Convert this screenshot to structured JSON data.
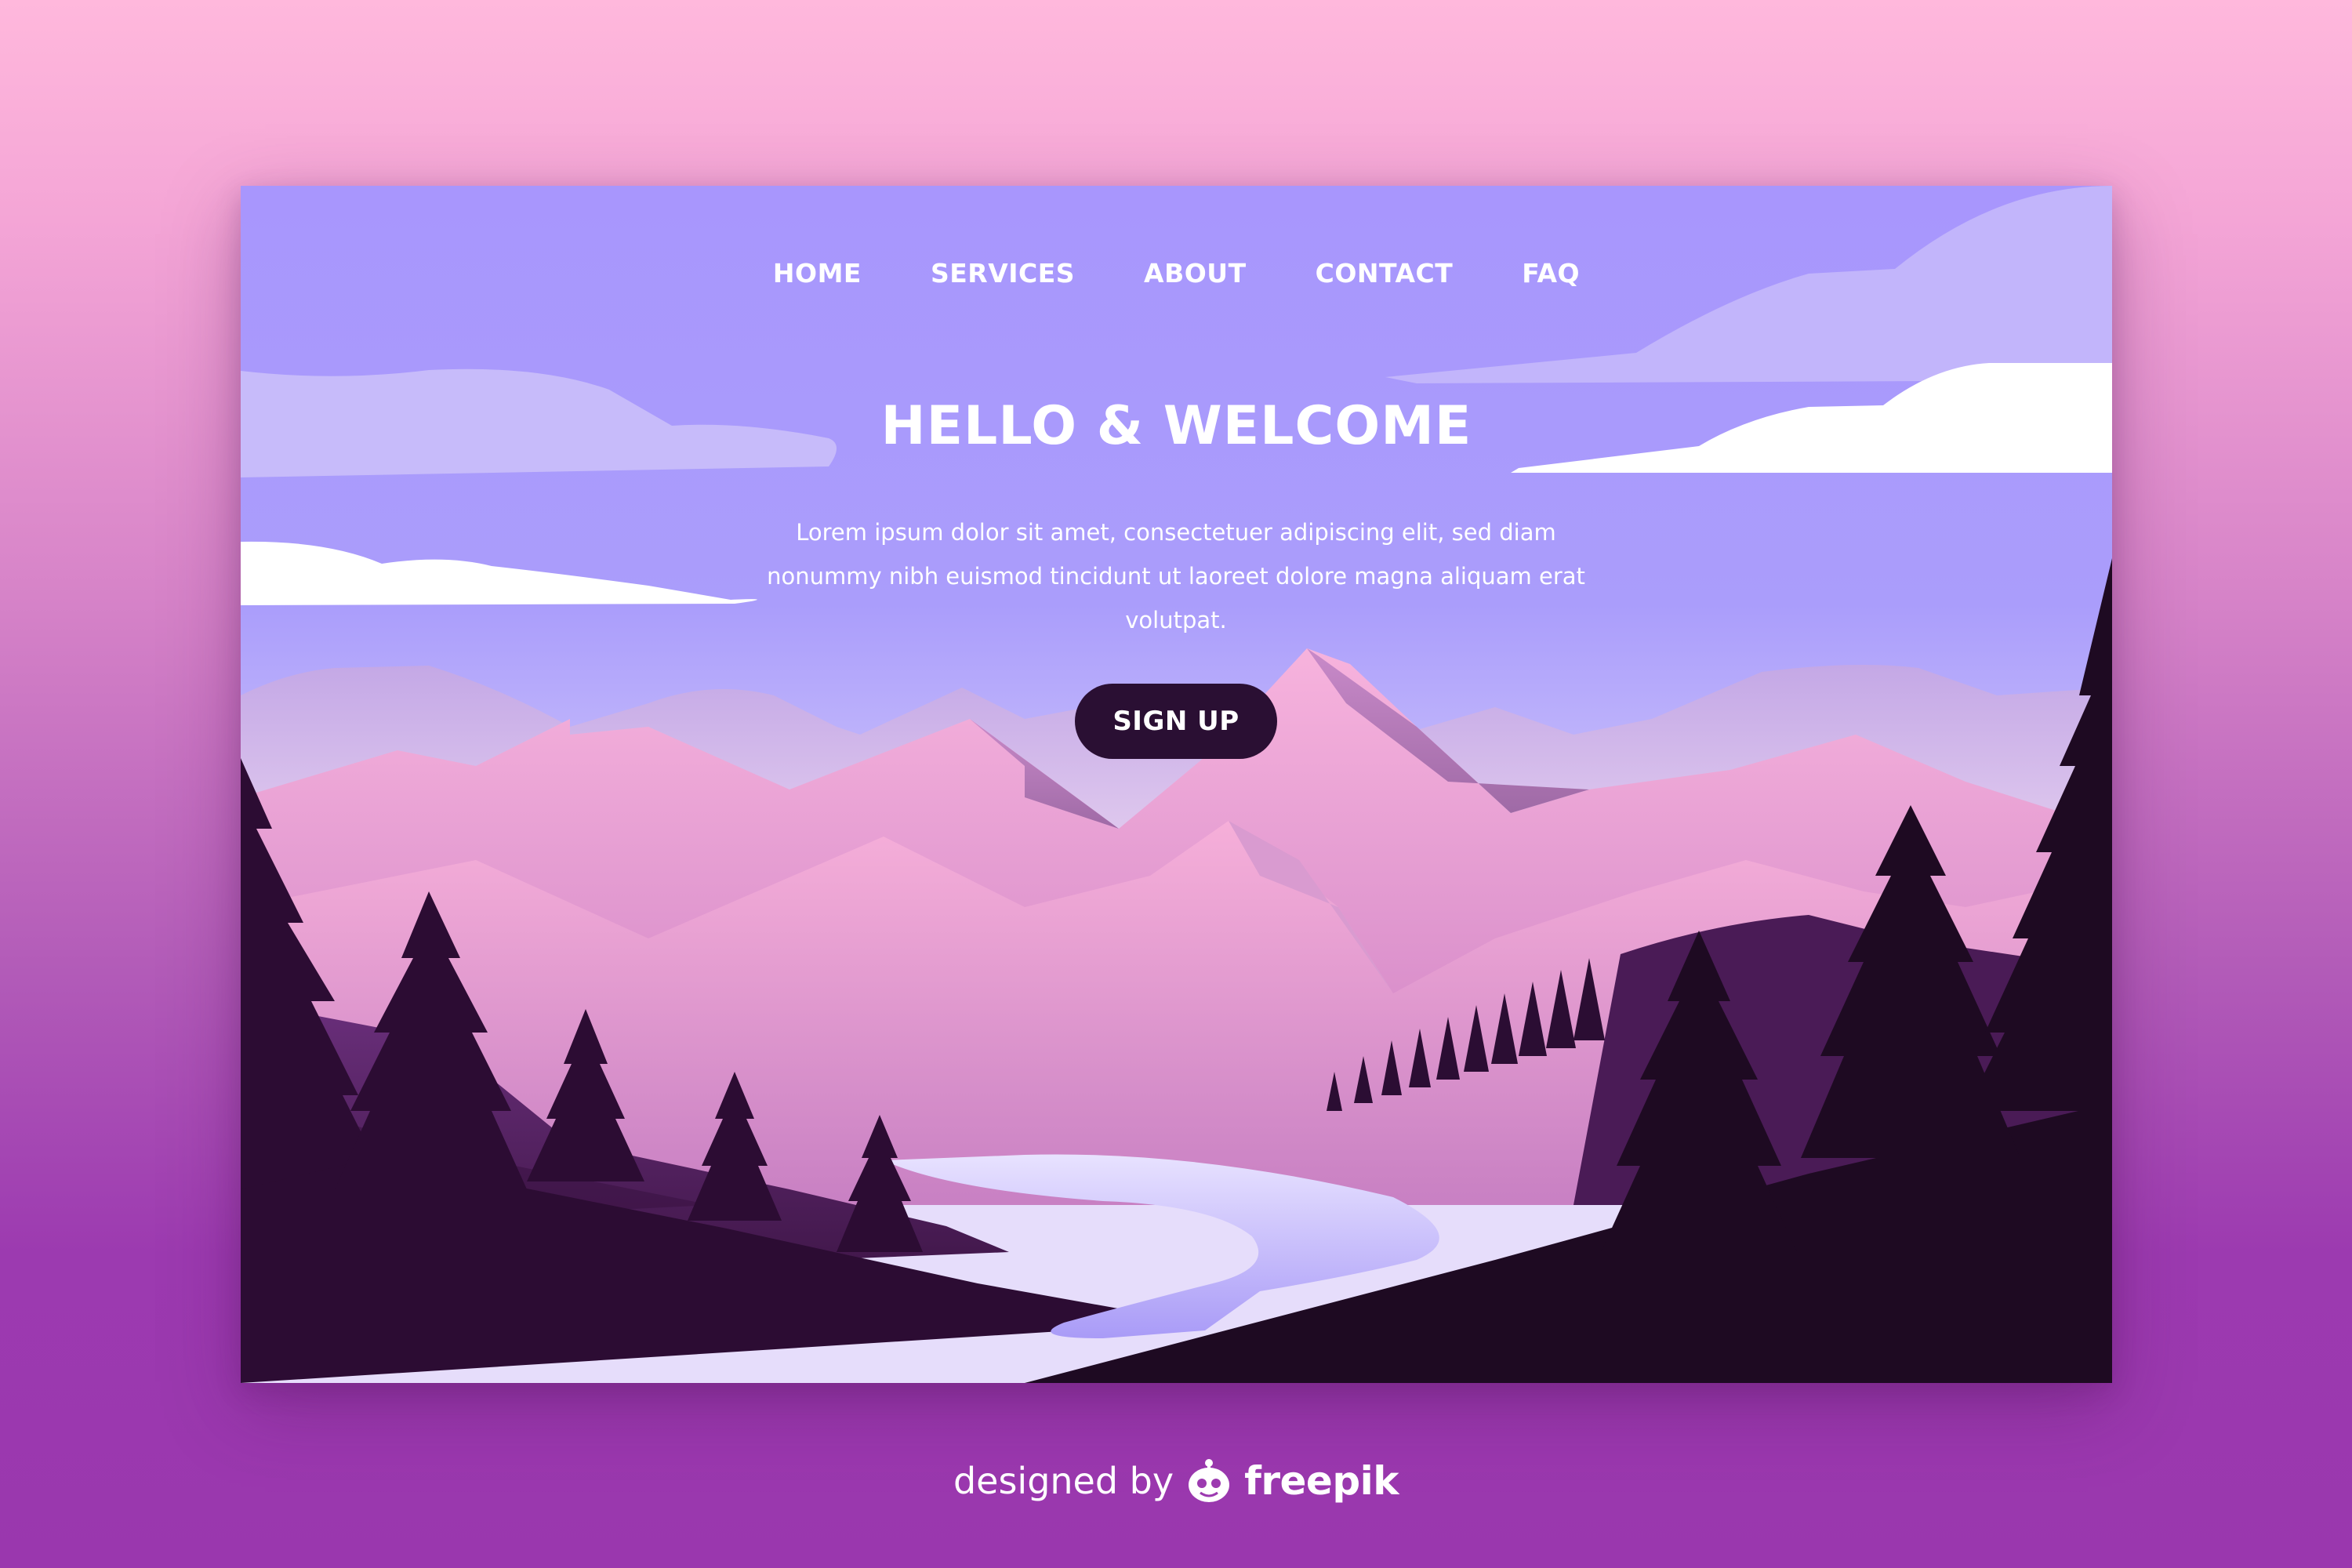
{
  "nav": {
    "items": [
      {
        "label": "HOME"
      },
      {
        "label": "SERVICES"
      },
      {
        "label": "ABOUT"
      },
      {
        "label": "CONTACT"
      },
      {
        "label": "FAQ"
      }
    ]
  },
  "hero": {
    "title": "HELLO & WELCOME",
    "body": "Lorem ipsum dolor sit amet, consectetuer adipiscing elit, sed diam nonummy nibh euismod tincidunt ut laoreet dolore magna aliquam erat volutpat.",
    "cta_label": "SIGN UP"
  },
  "credit": {
    "prefix": "designed by",
    "brand": "freepik"
  },
  "colors": {
    "sky_top": "#a896fd",
    "sky_bottom": "#e6ddfb",
    "button_bg": "#2a0f33",
    "tree_dark": "#1e0a22",
    "river": "#c3b6fa",
    "mountain_pink": "#f5a9d8"
  }
}
